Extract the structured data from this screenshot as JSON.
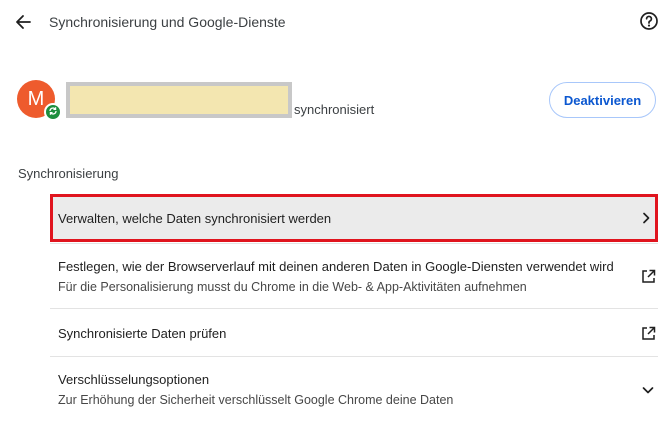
{
  "header": {
    "title": "Synchronisierung und Google-Dienste",
    "back_icon": "arrow-left-icon",
    "help_icon": "help-circle-icon"
  },
  "account": {
    "avatar_letter": "M",
    "avatar_color": "#ee5b2d",
    "badge_color": "#1e8e3e",
    "status": "synchronisiert",
    "deactivate_label": "Deaktivieren"
  },
  "section": {
    "heading": "Synchronisierung"
  },
  "items": [
    {
      "title": "Verwalten, welche Daten synchronisiert werden",
      "icon": "chevron-right-icon",
      "highlight_color": "#e0141e"
    },
    {
      "title": "Festlegen, wie der Browserverlauf mit deinen anderen Daten in Google-Diensten verwendet wird",
      "subtitle": "Für die Personalisierung musst du Chrome in die Web- & App-Aktivitäten aufnehmen",
      "icon": "open-in-new-icon"
    },
    {
      "title": "Synchronisierte Daten prüfen",
      "icon": "open-in-new-icon"
    },
    {
      "title": "Verschlüsselungsoptionen",
      "subtitle": "Zur Erhöhung der Sicherheit verschlüsselt Google Chrome deine Daten",
      "icon": "chevron-down-icon"
    }
  ],
  "colors": {
    "accent": "#0b57d0",
    "button_border": "#a8c7fa",
    "redaction_fill": "#f3e6b0",
    "redaction_border": "#c8c8c8"
  }
}
